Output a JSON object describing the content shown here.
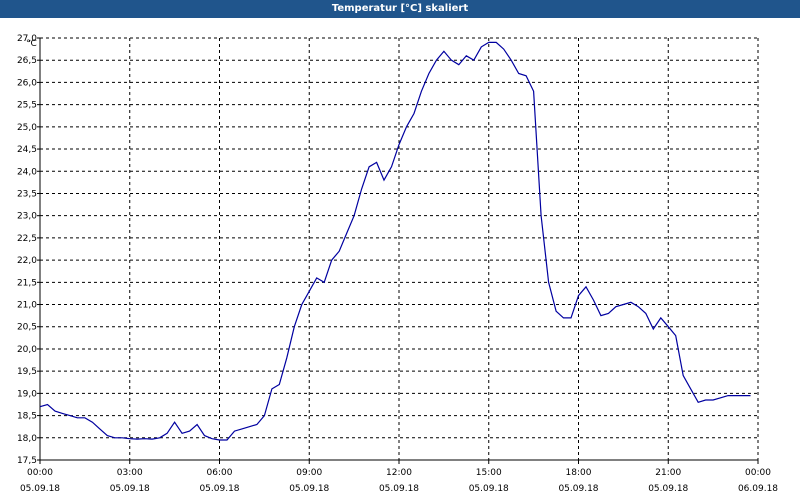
{
  "title": "Temperatur [°C] skaliert",
  "colors": {
    "title_bar": "#20558c",
    "line": "#0000a0",
    "grid": "#000000"
  },
  "chart_data": {
    "type": "line",
    "title": "Temperatur [°C] skaliert",
    "ylabel": "°C",
    "xlabel": "",
    "ylim": [
      17.5,
      27.0
    ],
    "xlim": [
      0,
      24
    ],
    "grid": true,
    "grid_style": "dashed",
    "y_ticks": [
      "17,5",
      "18,0",
      "18,5",
      "19,0",
      "19,5",
      "20,0",
      "20,5",
      "21,0",
      "21,5",
      "22,0",
      "22,5",
      "23,0",
      "23,5",
      "24,0",
      "24,5",
      "25,0",
      "25,5",
      "26,0",
      "26,5",
      "27,0"
    ],
    "x_ticks": [
      {
        "time": "00:00",
        "date": "05.09.18"
      },
      {
        "time": "03:00",
        "date": "05.09.18"
      },
      {
        "time": "06:00",
        "date": "05.09.18"
      },
      {
        "time": "09:00",
        "date": "05.09.18"
      },
      {
        "time": "12:00",
        "date": "05.09.18"
      },
      {
        "time": "15:00",
        "date": "05.09.18"
      },
      {
        "time": "18:00",
        "date": "05.09.18"
      },
      {
        "time": "21:00",
        "date": "05.09.18"
      },
      {
        "time": "00:00",
        "date": "06.09.18"
      }
    ],
    "series": [
      {
        "x": [
          0,
          0.25,
          0.5,
          0.75,
          1,
          1.25,
          1.5,
          1.75,
          2,
          2.25,
          2.5,
          2.75,
          3,
          3.25,
          3.5,
          3.75,
          4,
          4.25,
          4.5,
          4.75,
          5,
          5.25,
          5.5,
          5.75,
          6,
          6.25,
          6.5,
          6.75,
          7,
          7.25,
          7.5,
          7.75,
          8,
          8.25,
          8.5,
          8.75,
          9,
          9.25,
          9.5,
          9.75,
          10,
          10.25,
          10.5,
          10.75,
          11,
          11.25,
          11.5,
          11.75,
          12,
          12.25,
          12.5,
          12.75,
          13,
          13.25,
          13.5,
          13.75,
          14,
          14.25,
          14.5,
          14.75,
          15,
          15.25,
          15.5,
          15.75,
          16,
          16.25,
          16.5,
          16.75,
          17,
          17.25,
          17.5,
          17.75,
          18,
          18.25,
          18.5,
          18.75,
          19,
          19.25,
          19.5,
          19.75,
          20,
          20.25,
          20.5,
          20.75,
          21,
          21.25,
          21.5,
          21.75,
          22,
          22.25,
          22.5,
          22.75,
          23,
          23.25,
          23.5,
          23.75
        ],
        "values": [
          18.7,
          18.75,
          18.6,
          18.55,
          18.5,
          18.45,
          18.45,
          18.35,
          18.2,
          18.05,
          18.0,
          18.0,
          17.98,
          17.97,
          17.98,
          17.97,
          18.0,
          18.1,
          18.35,
          18.1,
          18.15,
          18.3,
          18.05,
          17.98,
          17.95,
          17.95,
          18.15,
          18.2,
          18.25,
          18.3,
          18.5,
          19.1,
          19.2,
          19.8,
          20.5,
          21.0,
          21.3,
          21.6,
          21.5,
          22.0,
          22.2,
          22.6,
          23.0,
          23.6,
          24.1,
          24.2,
          23.8,
          24.1,
          24.6,
          25.0,
          25.3,
          25.8,
          26.2,
          26.5,
          26.7,
          26.5,
          26.4,
          26.6,
          26.5,
          26.8,
          26.9,
          26.9,
          26.75,
          26.5,
          26.2,
          26.15,
          25.8,
          23.0,
          21.5,
          20.85,
          20.7,
          20.7,
          21.2,
          21.4,
          21.1,
          20.75,
          20.8,
          20.95,
          21.0,
          21.05,
          20.95,
          20.8,
          20.45,
          20.7,
          20.5,
          20.3,
          19.4,
          19.1,
          18.8,
          18.85,
          18.85,
          18.9,
          18.95,
          18.95,
          18.95,
          18.95
        ]
      }
    ]
  }
}
